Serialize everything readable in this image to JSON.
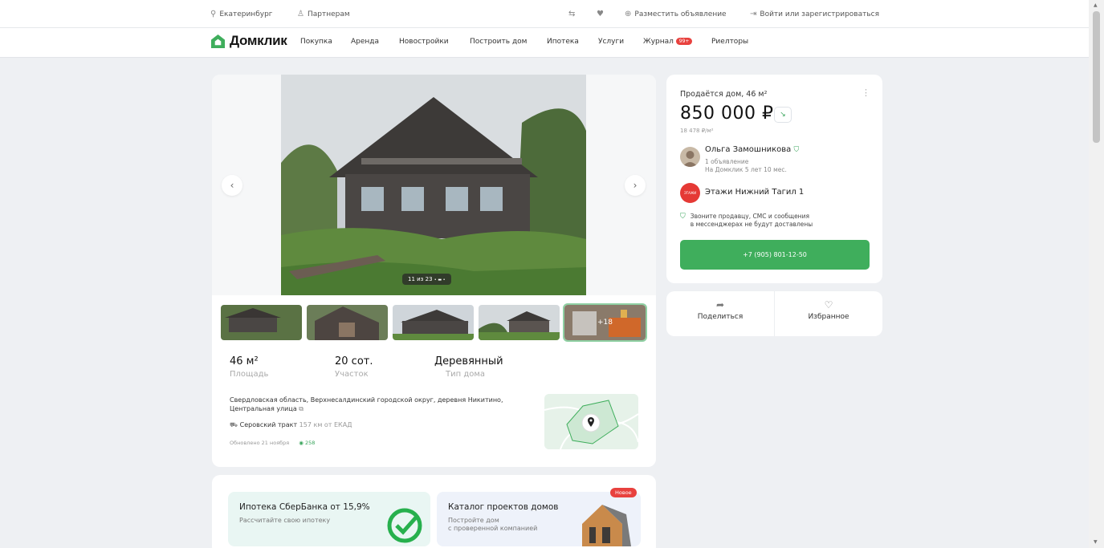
{
  "topbar": {
    "city": "Екатеринбург",
    "partners": "Партнерам",
    "post_ad": "Разместить объявление",
    "login": "Войти или зарегистрироваться"
  },
  "nav": {
    "logo": "Домклик",
    "items": [
      "Покупка",
      "Аренда",
      "Новостройки",
      "Построить дом",
      "Ипотека",
      "Услуги",
      "Журнал",
      "Риелторы"
    ],
    "journal_badge": "99+"
  },
  "gallery": {
    "counter": "11 из 23",
    "more_label": "+18"
  },
  "params": [
    {
      "value": "46 м²",
      "label": "Площадь"
    },
    {
      "value": "20 сот.",
      "label": "Участок"
    },
    {
      "value": "Деревянный",
      "label": "Тип дома"
    }
  ],
  "address": "Свердловская область, Верхнесалдинский городской округ, деревня Никитино, Центральная улица",
  "highway": {
    "name": "Серовский тракт",
    "distance": "157 км от ЕКАД"
  },
  "updated": "Обновлено 21 ноября",
  "views": "258",
  "promos": [
    {
      "title": "Ипотека СберБанка от 15,9%",
      "subtitle": "Рассчитайте свою ипотеку"
    },
    {
      "title": "Каталог проектов домов",
      "subtitle_line1": "Постройте дом",
      "subtitle_line2": "с проверенной компанией",
      "badge": "Новое"
    }
  ],
  "offer": {
    "title": "Продаётся дом, 46 м²",
    "price": "850 000 ₽",
    "price_per_m": "18 478 ₽/м²",
    "seller_name": "Ольга Замошникова",
    "seller_ads": "1 объявление",
    "seller_since": "На Домклик 5 лет 10 мес.",
    "agency": "Этажи Нижний Тагил 1",
    "notice_line1": "Звоните продавцу, СМС и сообщения",
    "notice_line2": "в мессенджерах не будут доставлены",
    "phone": "+7 (905) 801-12-50"
  },
  "actions": {
    "share": "Поделиться",
    "favorite": "Избранное"
  },
  "colors": {
    "accent": "#3fae5c",
    "badge": "#e8413e",
    "background": "#eef0f3"
  }
}
